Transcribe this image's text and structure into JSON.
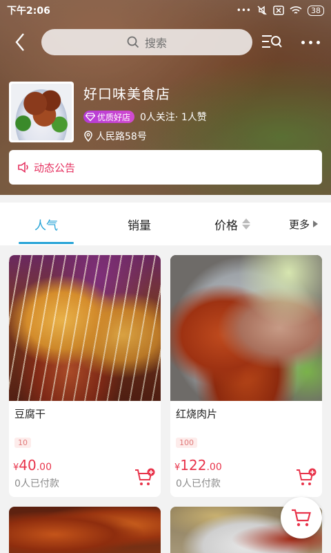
{
  "status_bar": {
    "time": "下午2:06",
    "battery": "38"
  },
  "navbar": {
    "search_placeholder": "搜索"
  },
  "store": {
    "name": "好口味美食店",
    "badge": "优质好店",
    "stats": "0人关注· 1人赞",
    "address": "人民路58号"
  },
  "notice": {
    "label": "动态公告"
  },
  "tabs": [
    {
      "label": "人气",
      "active": true
    },
    {
      "label": "销量",
      "active": false
    },
    {
      "label": "价格",
      "active": false
    },
    {
      "label": "更多",
      "active": false
    }
  ],
  "products": [
    {
      "name": "豆腐干",
      "tag": "10",
      "currency": "¥",
      "price_int": "40",
      "price_dec": ".00",
      "sold": "0人已付款"
    },
    {
      "name": "红烧肉片",
      "tag": "100",
      "currency": "¥",
      "price_int": "122",
      "price_dec": ".00",
      "sold": "0人已付款"
    }
  ],
  "colors": {
    "accent": "#23a2d6",
    "price": "#e8334a",
    "notice": "#e5305f",
    "badge": "#c63fd4"
  }
}
